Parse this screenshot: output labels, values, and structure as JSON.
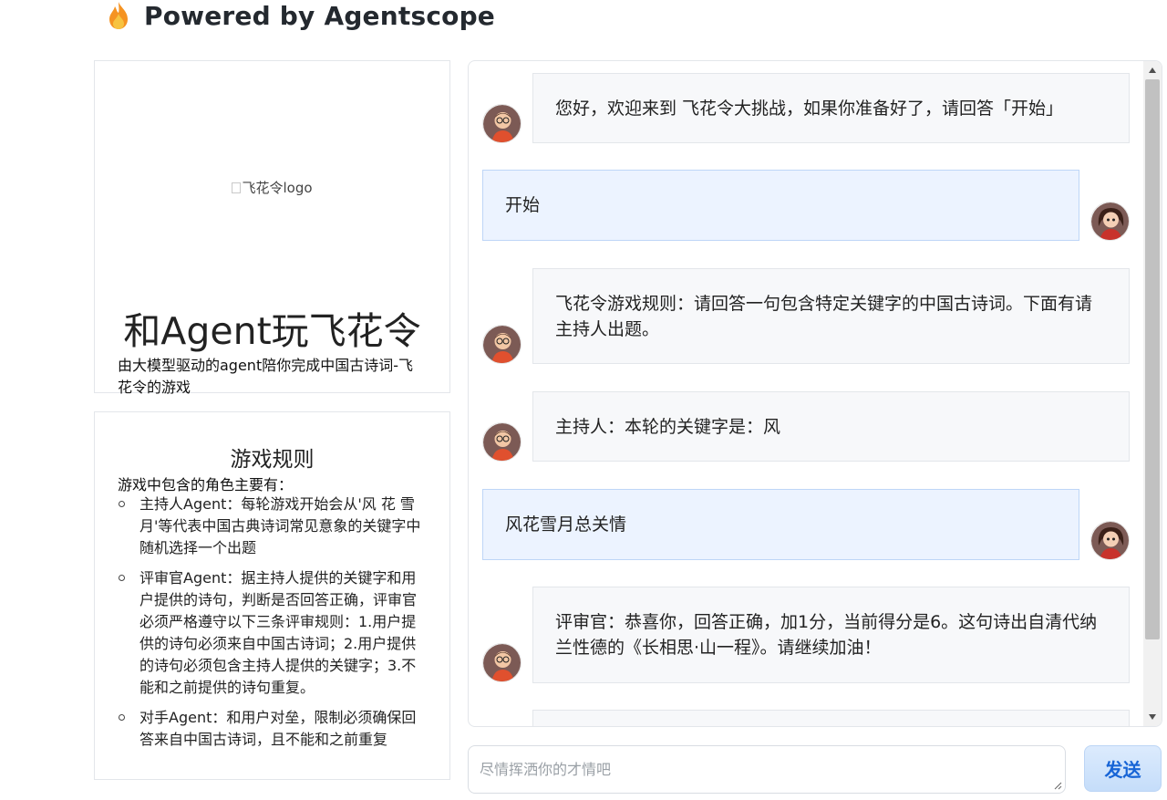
{
  "header": {
    "title": "Powered by Agentscope",
    "icon": "flame-icon"
  },
  "intro": {
    "logo_alt": "飞花令logo",
    "title": "和Agent玩飞花令",
    "subtitle": "由大模型驱动的agent陪你完成中国古诗词-飞花令的游戏"
  },
  "rules": {
    "title": "游戏规则",
    "intro": "游戏中包含的角色主要有：",
    "items": [
      "主持人Agent：每轮游戏开始会从'风 花 雪 月'等代表中国古典诗词常见意象的关键字中随机选择一个出题",
      "评审官Agent：据主持人提供的关键字和用户提供的诗句，判断是否回答正确，评审官必须严格遵守以下三条评审规则：1.用户提供的诗句必须来自中国古诗词；2.用户提供的诗句必须包含主持人提供的关键字；3.不能和之前提供的诗句重复。",
      "对手Agent：和用户对垒，限制必须确保回答来自中国古诗词，且不能和之前重复"
    ]
  },
  "chat": {
    "messages": [
      {
        "role": "bot",
        "text": "您好，欢迎来到 飞花令大挑战，如果你准备好了，请回答「开始」"
      },
      {
        "role": "user",
        "text": "开始"
      },
      {
        "role": "bot",
        "text": "飞花令游戏规则：请回答一句包含特定关键字的中国古诗词。下面有请主持人出题。"
      },
      {
        "role": "bot",
        "text": "主持人：本轮的关键字是：风"
      },
      {
        "role": "user",
        "text": "风花雪月总关情"
      },
      {
        "role": "bot",
        "text": "评审官：恭喜你，回答正确，加1分，当前得分是6。这句诗出自清代纳兰性德的《长相思·山一程》。请继续加油！"
      },
      {
        "role": "bot",
        "text": ""
      }
    ]
  },
  "input": {
    "placeholder": "尽情挥洒你的才情吧",
    "value": ""
  },
  "send_button": {
    "label": "发送"
  },
  "colors": {
    "accent": "#1764d6",
    "user_bubble": "#ecf3ff",
    "bot_bubble": "#f7f8fa",
    "border": "#e3e6ea"
  }
}
